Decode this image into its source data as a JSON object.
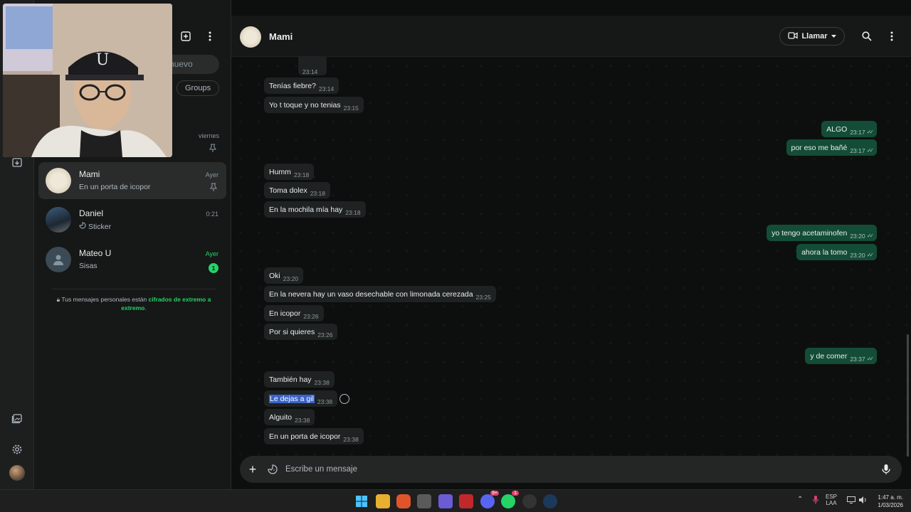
{
  "window": {
    "minimize": "—",
    "maximize": "❐",
    "close": "✕"
  },
  "sidebar": {
    "search_placeholder_fragment": "nuevo",
    "filter_chip": "Groups",
    "partial_chat_time": "viernes",
    "chats": [
      {
        "name": "Mami",
        "preview": "En un porta de icopor",
        "time": "Ayer",
        "pinned": true,
        "active": true
      },
      {
        "name": "Daniel",
        "preview": "Sticker",
        "time": "0:21",
        "icon": "sticker-icon"
      },
      {
        "name": "Mateo U",
        "preview": "Sisas",
        "time": "Ayer",
        "unread": "1",
        "time_color": "#25d366"
      }
    ],
    "e2e_notice": {
      "prefix": "Tus mensajes personales están ",
      "link": "cifrados de extremo a extremo",
      "suffix": "."
    }
  },
  "chat": {
    "contact_name": "Mami",
    "call_label": "Llamar",
    "partial_time": "23:14",
    "messages": [
      {
        "dir": "in",
        "text": "Tenías fiebre?",
        "time": "23:14"
      },
      {
        "dir": "in",
        "text": "Yo t toque y no tenias",
        "time": "23:15"
      },
      {
        "dir": "out",
        "text": "ALGO",
        "time": "23:17"
      },
      {
        "dir": "out",
        "text": "por eso me bañé",
        "time": "23:17"
      },
      {
        "dir": "in",
        "text": "Humm",
        "time": "23:18"
      },
      {
        "dir": "in",
        "text": "Toma dolex",
        "time": "23:18"
      },
      {
        "dir": "in",
        "text": "En la mochila mía hay",
        "time": "23:18"
      },
      {
        "dir": "out",
        "text": "yo tengo acetaminofen",
        "time": "23:20"
      },
      {
        "dir": "out",
        "text": "ahora la tomo",
        "time": "23:20"
      },
      {
        "dir": "in",
        "text": "Oki",
        "time": "23:20"
      },
      {
        "dir": "in",
        "text": "En la nevera hay un vaso desechable con limonada cerezada",
        "time": "23:25"
      },
      {
        "dir": "in",
        "text": "En icopor",
        "time": "23:26"
      },
      {
        "dir": "in",
        "text": "Por si quieres",
        "time": "23:26"
      },
      {
        "dir": "out",
        "text": "y de comer",
        "time": "23:37"
      },
      {
        "dir": "in",
        "text": "También hay",
        "time": "23:38"
      },
      {
        "dir": "in",
        "text": "Le dejas a gil",
        "time": "23:38",
        "selected": true
      },
      {
        "dir": "in",
        "text": "Alguito",
        "time": "23:38"
      },
      {
        "dir": "in",
        "text": "En un porta de icopor",
        "time": "23:38"
      }
    ],
    "composer_placeholder": "Escribe un mensaje"
  },
  "taskbar": {
    "lang_top": "ESP",
    "lang_bottom": "LAA",
    "time": "1:47 a. m.",
    "date": "1/03/2026",
    "badges": {
      "discord": "9+",
      "whatsapp": "1"
    }
  },
  "colors": {
    "accent": "#25d366",
    "outgoing_bubble": "#144d37",
    "incoming_bubble": "#1f2222",
    "selection": "#3a63c9"
  }
}
